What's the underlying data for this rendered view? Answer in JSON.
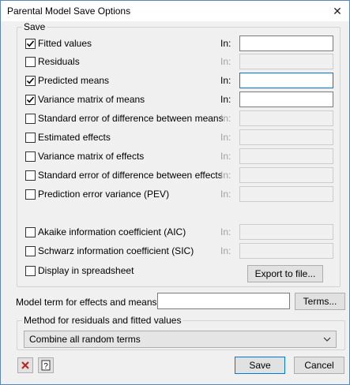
{
  "window": {
    "title": "Parental Model Save Options"
  },
  "save_group": {
    "legend": "Save",
    "in_label": "In:",
    "options": [
      {
        "label": "Fitted values",
        "checked": true,
        "in_enabled": true
      },
      {
        "label": "Residuals",
        "checked": false,
        "in_enabled": false
      },
      {
        "label": "Predicted means",
        "checked": true,
        "in_enabled": true
      },
      {
        "label": "Variance matrix of means",
        "checked": true,
        "in_enabled": true
      },
      {
        "label": "Standard error of difference between means",
        "checked": false,
        "in_enabled": false
      },
      {
        "label": "Estimated effects",
        "checked": false,
        "in_enabled": false
      },
      {
        "label": "Variance matrix of effects",
        "checked": false,
        "in_enabled": false
      },
      {
        "label": "Standard error of difference between effects",
        "checked": false,
        "in_enabled": false
      },
      {
        "label": "Prediction error variance (PEV)",
        "checked": false,
        "in_enabled": false
      },
      {
        "label": "Akaike information coefficient (AIC)",
        "checked": false,
        "in_enabled": false
      },
      {
        "label": "Schwarz information coefficient (SIC)",
        "checked": false,
        "in_enabled": false
      }
    ],
    "display_in_spreadsheet": {
      "label": "Display in spreadsheet",
      "checked": false
    },
    "export_button": "Export to file..."
  },
  "model_term": {
    "label": "Model term for effects and means:",
    "value": "",
    "terms_button": "Terms..."
  },
  "method_group": {
    "legend": "Method for residuals and fitted values",
    "selected": "Combine all random terms"
  },
  "footer": {
    "save_button": "Save",
    "cancel_button": "Cancel"
  }
}
